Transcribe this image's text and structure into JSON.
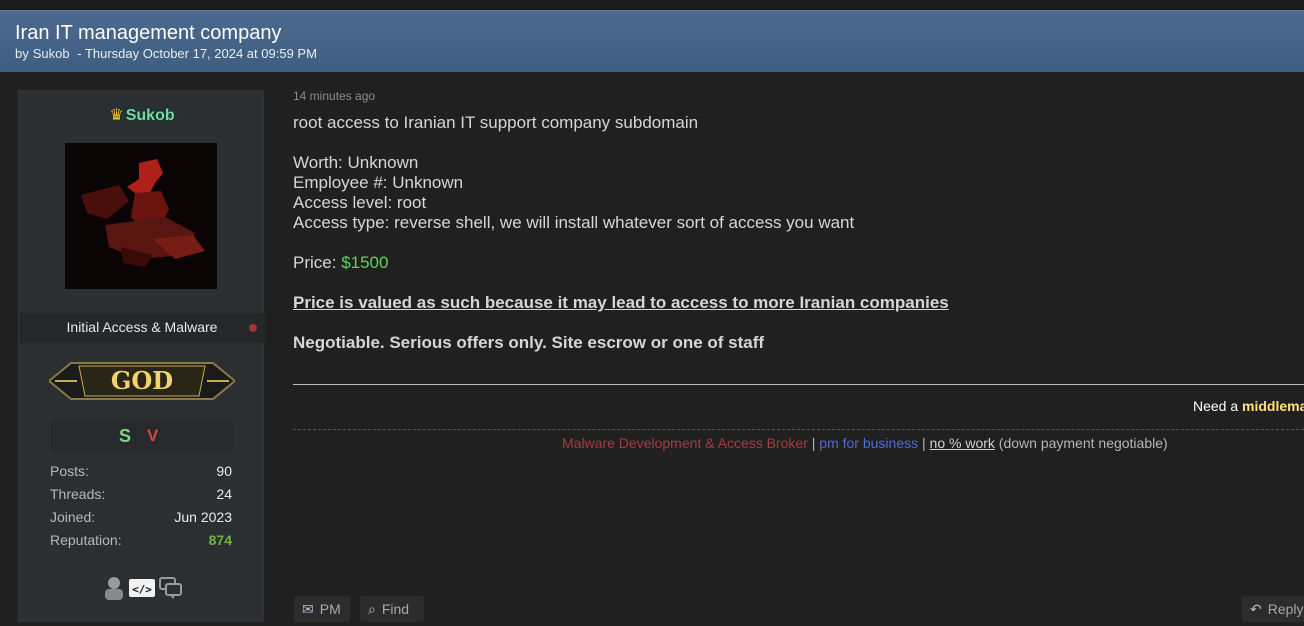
{
  "thread": {
    "title": "Iran IT management company",
    "by_label": "by",
    "author": "Sukob",
    "posted": "- Thursday October 17, 2024 at 09:59 PM"
  },
  "user": {
    "crown_icon": "crown-icon",
    "name": "Sukob",
    "usertitle": "Initial Access & Malware",
    "badge_text": "GOD",
    "awards": [
      "S",
      "V"
    ],
    "stats": [
      {
        "label": "Posts:",
        "value": "90"
      },
      {
        "label": "Threads:",
        "value": "24"
      },
      {
        "label": "Joined:",
        "value": "Jun 2023"
      },
      {
        "label": "Reputation:",
        "value": "874"
      }
    ],
    "profile_icons": [
      "user-icon",
      "code-icon",
      "chat-icon"
    ]
  },
  "post": {
    "time": "14 minutes ago",
    "intro": "root access to Iranian IT support company subdomain",
    "worth": "Worth: Unknown",
    "employees": "Employee #: Unknown",
    "access_level": "Access level: root",
    "access_type": "Access type: reverse shell, we will install whatever sort of access you want",
    "price_label": "Price: ",
    "price_value": "$1500",
    "price_note": "Price is valued as such because it may lead to access to more Iranian companies",
    "negotiable": "Negotiable. Serious offers only. Site escrow or one of staff"
  },
  "signature": {
    "middleman_prefix": "Need a ",
    "middleman_bold": "middlema",
    "part1": "Malware Development & Access Broker",
    "sep1": " | ",
    "part2": "pm for business",
    "sep2": " | ",
    "part3": "no % work",
    "part4": " (down payment negotiable)"
  },
  "buttons": {
    "pm": "PM",
    "find": "Find",
    "reply": "Reply"
  },
  "colors": {
    "header": "#4b6a8f",
    "price": "#5fd35a",
    "username_glow": "#7fd5a5",
    "reputation": "#6cb33f"
  }
}
